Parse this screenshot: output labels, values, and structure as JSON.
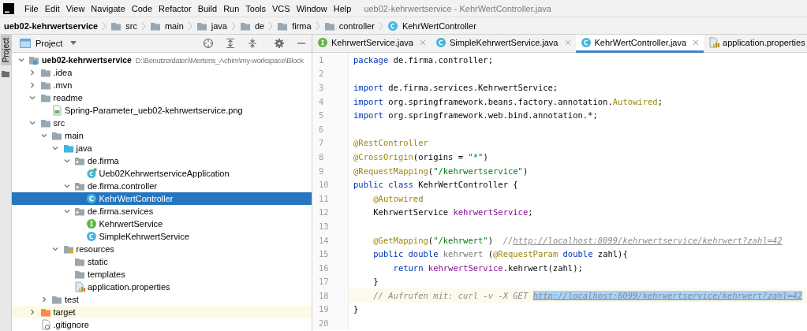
{
  "window": {
    "title": "ueb02-kehrwertservice - KehrWertController.java"
  },
  "menu": [
    "File",
    "Edit",
    "View",
    "Navigate",
    "Code",
    "Refactor",
    "Build",
    "Run",
    "Tools",
    "VCS",
    "Window",
    "Help"
  ],
  "breadcrumbs": [
    {
      "label": "ueb02-kehrwertservice",
      "kind": "project"
    },
    {
      "label": "src",
      "kind": "folder"
    },
    {
      "label": "main",
      "kind": "folder"
    },
    {
      "label": "java",
      "kind": "folder"
    },
    {
      "label": "de",
      "kind": "folder"
    },
    {
      "label": "firma",
      "kind": "folder"
    },
    {
      "label": "controller",
      "kind": "folder"
    },
    {
      "label": "KehrWertController",
      "kind": "class"
    }
  ],
  "side_stripe": {
    "label": "Project"
  },
  "project_panel": {
    "title": "Project",
    "tree": [
      {
        "label": "ueb02-kehrwertservice",
        "hint": "D:\\Benutzerdaten\\Mertens_Achim\\my-workspace\\Block",
        "kind": "module",
        "expanded": true,
        "selected": false,
        "children": [
          {
            "label": ".idea",
            "kind": "folder",
            "expanded": false,
            "selected": false
          },
          {
            "label": ".mvn",
            "kind": "folder",
            "expanded": false,
            "selected": false
          },
          {
            "label": "readme",
            "kind": "folder",
            "expanded": true,
            "selected": false,
            "children": [
              {
                "label": "Spring-Parameter_ueb02-kehrwertservice.png",
                "kind": "image",
                "selected": false
              }
            ]
          },
          {
            "label": "src",
            "kind": "folder",
            "expanded": true,
            "selected": false,
            "children": [
              {
                "label": "main",
                "kind": "folder",
                "expanded": true,
                "selected": false,
                "children": [
                  {
                    "label": "java",
                    "kind": "source-folder",
                    "expanded": true,
                    "selected": false,
                    "children": [
                      {
                        "label": "de.firma",
                        "kind": "package",
                        "expanded": true,
                        "selected": false,
                        "children": [
                          {
                            "label": "Ueb02KehrwertserviceApplication",
                            "kind": "spring-class",
                            "selected": false
                          }
                        ]
                      },
                      {
                        "label": "de.firma.controller",
                        "kind": "package",
                        "expanded": true,
                        "selected": false,
                        "children": [
                          {
                            "label": "KehrWertController",
                            "kind": "class",
                            "selected": true
                          }
                        ]
                      },
                      {
                        "label": "de.firma.services",
                        "kind": "package",
                        "expanded": true,
                        "selected": false,
                        "children": [
                          {
                            "label": "KehrwertService",
                            "kind": "interface",
                            "selected": false
                          },
                          {
                            "label": "SimpleKehrwertService",
                            "kind": "class",
                            "selected": false
                          }
                        ]
                      }
                    ]
                  },
                  {
                    "label": "resources",
                    "kind": "resources-folder",
                    "expanded": true,
                    "selected": false,
                    "children": [
                      {
                        "label": "static",
                        "kind": "folder",
                        "selected": false
                      },
                      {
                        "label": "templates",
                        "kind": "folder",
                        "selected": false
                      },
                      {
                        "label": "application.properties",
                        "kind": "properties",
                        "selected": false
                      }
                    ]
                  }
                ]
              },
              {
                "label": "test",
                "kind": "folder",
                "expanded": false,
                "selected": false
              }
            ]
          },
          {
            "label": "target",
            "kind": "excluded-folder",
            "expanded": false,
            "selected": false
          },
          {
            "label": ".gitignore",
            "kind": "ignore-file",
            "selected": false
          }
        ]
      }
    ]
  },
  "editor_tabs": [
    {
      "label": "KehrwertService.java",
      "kind": "interface",
      "selected": false
    },
    {
      "label": "SimpleKehrwertService.java",
      "kind": "class",
      "selected": false
    },
    {
      "label": "KehrWertController.java",
      "kind": "class",
      "selected": true
    },
    {
      "label": "application.properties",
      "kind": "properties",
      "selected": false
    }
  ],
  "editor": {
    "lines": [
      {
        "number": "1",
        "current": false,
        "tokens": [
          {
            "kind": "keyword",
            "text": "package"
          },
          {
            "kind": "plain",
            "text": " de.firma.controller;"
          }
        ]
      },
      {
        "number": "2",
        "current": false
      },
      {
        "number": "3",
        "current": false,
        "tokens": [
          {
            "kind": "keyword",
            "text": "import"
          },
          {
            "kind": "plain",
            "text": " de.firma.services.KehrwertService;"
          }
        ]
      },
      {
        "number": "4",
        "current": false,
        "tokens": [
          {
            "kind": "keyword",
            "text": "import"
          },
          {
            "kind": "plain",
            "text": " org.springframework.beans.factory.annotation."
          },
          {
            "kind": "annotation",
            "text": "Autowired"
          },
          {
            "kind": "plain",
            "text": ";"
          }
        ]
      },
      {
        "number": "5",
        "current": false,
        "tokens": [
          {
            "kind": "keyword",
            "text": "import"
          },
          {
            "kind": "plain",
            "text": " org.springframework.web.bind.annotation.*;"
          }
        ]
      },
      {
        "number": "6",
        "current": false
      },
      {
        "number": "7",
        "current": false,
        "tokens": [
          {
            "kind": "annotation",
            "text": "@RestController"
          }
        ]
      },
      {
        "number": "8",
        "current": false,
        "tokens": [
          {
            "kind": "annotation",
            "text": "@CrossOrigin"
          },
          {
            "kind": "plain",
            "text": "(origins = "
          },
          {
            "kind": "string",
            "text": "\"*\""
          },
          {
            "kind": "plain",
            "text": ")"
          }
        ]
      },
      {
        "number": "9",
        "current": false,
        "tokens": [
          {
            "kind": "annotation",
            "text": "@RequestMapping"
          },
          {
            "kind": "plain",
            "text": "("
          },
          {
            "kind": "string",
            "text": "\"/kehrwertservice\""
          },
          {
            "kind": "plain",
            "text": ")"
          }
        ]
      },
      {
        "number": "10",
        "current": false,
        "tokens": [
          {
            "kind": "keyword",
            "text": "public class"
          },
          {
            "kind": "plain",
            "text": " KehrWertController {"
          }
        ]
      },
      {
        "number": "11",
        "current": false,
        "tokens": [
          {
            "kind": "annotation",
            "text": "    @Autowired"
          }
        ]
      },
      {
        "number": "12",
        "current": false,
        "tokens": [
          {
            "kind": "plain",
            "text": "    KehrwertService "
          },
          {
            "kind": "field",
            "text": "kehrwertService"
          },
          {
            "kind": "plain",
            "text": ";"
          }
        ]
      },
      {
        "number": "13",
        "current": false
      },
      {
        "number": "14",
        "current": false,
        "tokens": [
          {
            "kind": "annotation",
            "text": "    @GetMapping"
          },
          {
            "kind": "plain",
            "text": "("
          },
          {
            "kind": "string",
            "text": "\"/kehrwert\""
          },
          {
            "kind": "plain",
            "text": ")  "
          },
          {
            "kind": "comment",
            "text": "//"
          },
          {
            "kind": "link",
            "text": "http://localhost:8099/kehrwertservice/kehrwert?zahl=42"
          }
        ]
      },
      {
        "number": "15",
        "current": false,
        "tokens": [
          {
            "kind": "keyword",
            "text": "    public double "
          },
          {
            "kind": "unused",
            "text": "kehrwert"
          },
          {
            "kind": "plain",
            "text": " ("
          },
          {
            "kind": "annotation",
            "text": "@RequestParam "
          },
          {
            "kind": "keyword",
            "text": "double"
          },
          {
            "kind": "plain",
            "text": " zahl){"
          }
        ]
      },
      {
        "number": "16",
        "current": false,
        "tokens": [
          {
            "kind": "keyword",
            "text": "        return "
          },
          {
            "kind": "field",
            "text": "kehrwertService"
          },
          {
            "kind": "plain",
            "text": ".kehrwert(zahl);"
          }
        ]
      },
      {
        "number": "17",
        "current": false,
        "tokens": [
          {
            "kind": "plain",
            "text": "    }"
          }
        ]
      },
      {
        "number": "18",
        "current": true,
        "tokens": [
          {
            "kind": "comment",
            "text": "    // Aufrufen mit: curl -v -X GET "
          },
          {
            "kind": "selected-link",
            "text": "http://localhost:8099/kehrwertservice/kehrwert?zahl=42"
          }
        ]
      },
      {
        "number": "19",
        "current": false,
        "tokens": [
          {
            "kind": "plain",
            "text": "}"
          }
        ]
      },
      {
        "number": "20",
        "current": false
      }
    ]
  }
}
